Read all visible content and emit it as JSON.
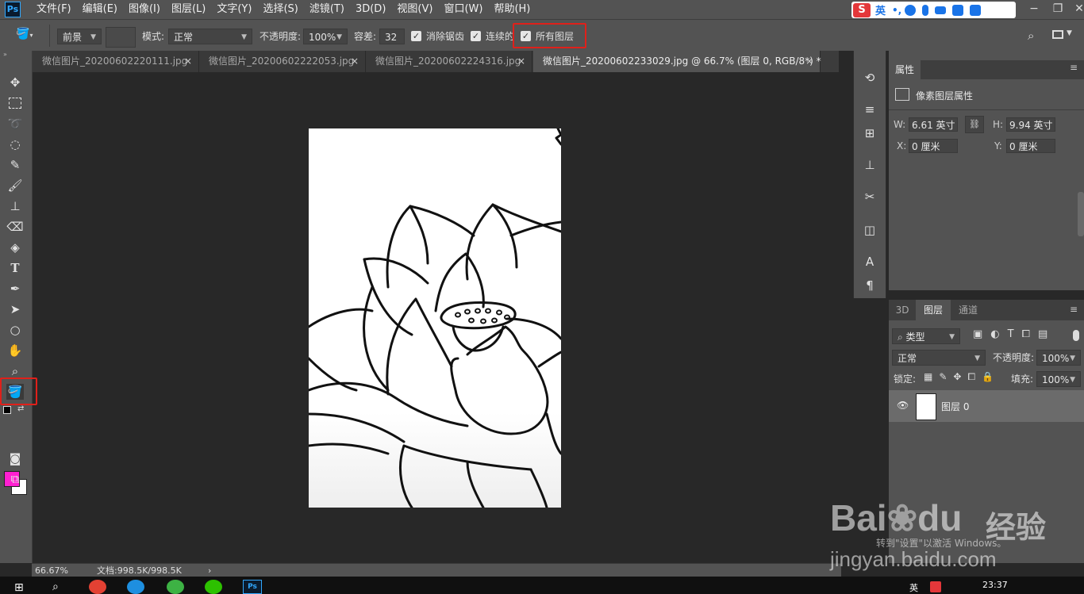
{
  "menubar": {
    "logo": "Ps",
    "items": [
      "文件(F)",
      "编辑(E)",
      "图像(I)",
      "图层(L)",
      "文字(Y)",
      "选择(S)",
      "滤镜(T)",
      "3D(D)",
      "视图(V)",
      "窗口(W)",
      "帮助(H)"
    ],
    "ime_lang": "英",
    "ime_logo": "S"
  },
  "options": {
    "fill_source": "前景",
    "mode_label": "模式:",
    "mode_value": "正常",
    "opacity_label": "不透明度:",
    "opacity_value": "100%",
    "tolerance_label": "容差:",
    "tolerance_value": "32",
    "antialias_label": "消除锯齿",
    "contiguous_label": "连续的",
    "all_layers_label": "所有图层"
  },
  "tabs": [
    {
      "label": "微信图片_20200602220111.jpg",
      "close": "×"
    },
    {
      "label": "微信图片_20200602222053.jpg",
      "close": "×"
    },
    {
      "label": "微信图片_20200602224316.jpg",
      "close": "×"
    },
    {
      "label": "微信图片_20200602233029.jpg @ 66.7% (图层 0, RGB/8*) *",
      "close": "×"
    }
  ],
  "colors": {
    "foreground": "#ff1fd1",
    "background": "#ffffff",
    "highlight": "#e0201a"
  },
  "status": {
    "zoom": "66.67%",
    "doc": "文档:998.5K/998.5K",
    "arrow": "›"
  },
  "properties": {
    "title": "属性",
    "subtitle": "像素图层属性",
    "w_label": "W:",
    "w_value": "6.61 英寸",
    "h_label": "H:",
    "h_value": "9.94 英寸",
    "x_label": "X:",
    "x_value": "0 厘米",
    "y_label": "Y:",
    "y_value": "0 厘米"
  },
  "layers": {
    "tabs": [
      "3D",
      "图层",
      "通道"
    ],
    "filter_label": "类型",
    "blend_mode": "正常",
    "opacity_label": "不透明度:",
    "opacity_value": "100%",
    "lock_label": "锁定:",
    "fill_label": "填充:",
    "fill_value": "100%",
    "items": [
      {
        "name": "图层 0"
      }
    ]
  },
  "taskbar": {
    "time": "23:37",
    "lang": "英"
  },
  "watermark": {
    "brand": "Bai",
    "brand2": "du",
    "cn": "经验",
    "url": "jingyan.baidu.com",
    "activate": "转到\"设置\"以激活 Windows。"
  }
}
